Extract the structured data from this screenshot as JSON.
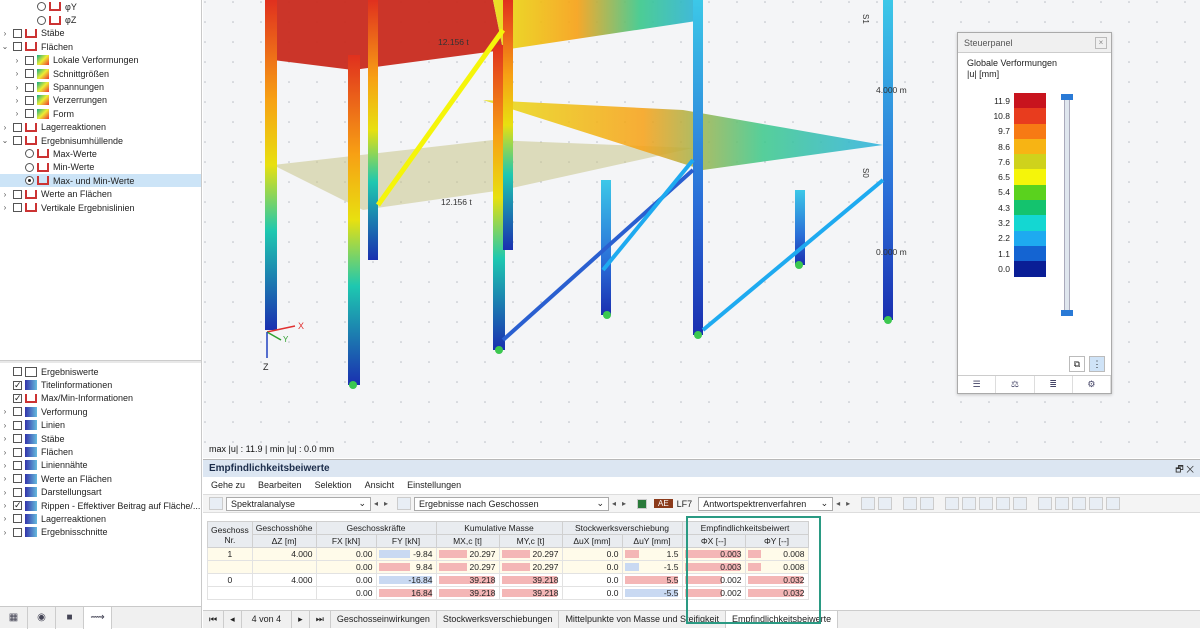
{
  "tree_top": [
    {
      "label": "φY",
      "kind": "radio",
      "indent": 3
    },
    {
      "label": "φZ",
      "kind": "radio",
      "indent": 3
    },
    {
      "label": "Stäbe",
      "kind": "check",
      "indent": 1,
      "expand": "›"
    },
    {
      "label": "Flächen",
      "kind": "check",
      "indent": 1,
      "expand": "⌄"
    },
    {
      "label": "Lokale Verformungen",
      "kind": "check",
      "indent": 2,
      "expand": "›",
      "icon": "surf"
    },
    {
      "label": "Schnittgrößen",
      "kind": "check",
      "indent": 2,
      "expand": "›",
      "icon": "surf"
    },
    {
      "label": "Spannungen",
      "kind": "check",
      "indent": 2,
      "expand": "›",
      "icon": "surf"
    },
    {
      "label": "Verzerrungen",
      "kind": "check",
      "indent": 2,
      "expand": "›",
      "icon": "surf"
    },
    {
      "label": "Form",
      "kind": "check",
      "indent": 2,
      "expand": "›",
      "icon": "surf"
    },
    {
      "label": "Lagerreaktionen",
      "kind": "check",
      "indent": 1,
      "expand": "›"
    },
    {
      "label": "Ergebnisumhüllende",
      "kind": "check",
      "indent": 1,
      "expand": "⌄",
      "icon": "red"
    },
    {
      "label": "Max-Werte",
      "kind": "radio",
      "indent": 2,
      "icon": "red"
    },
    {
      "label": "Min-Werte",
      "kind": "radio",
      "indent": 2,
      "icon": "red"
    },
    {
      "label": "Max- und Min-Werte",
      "kind": "radio",
      "on": true,
      "indent": 2,
      "icon": "red",
      "selected": true
    },
    {
      "label": "Werte an Flächen",
      "kind": "check",
      "indent": 1,
      "expand": "›"
    },
    {
      "label": "Vertikale Ergebnislinien",
      "kind": "check",
      "indent": 1,
      "expand": "›",
      "icon": "red"
    }
  ],
  "tree_bottom": [
    {
      "label": "Ergebniswerte",
      "checked": false,
      "icon": "mm",
      "expand": ""
    },
    {
      "label": "Titelinformationen",
      "checked": true,
      "icon": "blue",
      "expand": ""
    },
    {
      "label": "Max/Min-Informationen",
      "checked": true,
      "icon": "red",
      "expand": ""
    },
    {
      "label": "Verformung",
      "checked": false,
      "icon": "blue",
      "expand": "›"
    },
    {
      "label": "Linien",
      "checked": false,
      "icon": "blue",
      "expand": "›"
    },
    {
      "label": "Stäbe",
      "checked": false,
      "icon": "blue",
      "expand": "›"
    },
    {
      "label": "Flächen",
      "checked": false,
      "icon": "blue",
      "expand": "›"
    },
    {
      "label": "Liniennähte",
      "checked": false,
      "icon": "blue",
      "expand": "›"
    },
    {
      "label": "Werte an Flächen",
      "checked": false,
      "icon": "blue",
      "expand": "›"
    },
    {
      "label": "Darstellungsart",
      "checked": false,
      "icon": "blue",
      "expand": "›"
    },
    {
      "label": "Rippen - Effektiver Beitrag auf Fläche/...",
      "checked": true,
      "icon": "blue",
      "expand": "›"
    },
    {
      "label": "Lagerreaktionen",
      "checked": false,
      "icon": "blue",
      "expand": "›"
    },
    {
      "label": "Ergebnisschnitte",
      "checked": false,
      "icon": "blue",
      "expand": "›"
    }
  ],
  "viewport": {
    "status": "max |u| : 11.9 | min |u| : 0.0 mm",
    "label_mass1": "12.156 t",
    "label_mass2": "12.156 t",
    "label_height1": "4.000 m",
    "label_height2": "0.000 m",
    "label_s1": "S1",
    "label_s0": "S0",
    "axis_x": "X",
    "axis_y": "Y",
    "axis_z": "Z"
  },
  "panel": {
    "header": "Steuerpanel",
    "close": "×",
    "title1": "Globale Verformungen",
    "title2": "|u| [mm]",
    "legend": [
      {
        "value": "11.9",
        "color": "#c8141e"
      },
      {
        "value": "10.8",
        "color": "#e83c1e"
      },
      {
        "value": "9.7",
        "color": "#f77a14"
      },
      {
        "value": "8.6",
        "color": "#f7b414"
      },
      {
        "value": "7.6",
        "color": "#cfd21c"
      },
      {
        "value": "6.5",
        "color": "#f5f50a"
      },
      {
        "value": "5.4",
        "color": "#5ad21e"
      },
      {
        "value": "4.3",
        "color": "#14c36e"
      },
      {
        "value": "3.2",
        "color": "#14d7d2"
      },
      {
        "value": "2.2",
        "color": "#1eaaf0"
      },
      {
        "value": "1.1",
        "color": "#1464d2"
      },
      {
        "value": "0.0",
        "color": "#0a1e96"
      }
    ],
    "slider_top": 1.0,
    "slider_bottom": 0.0
  },
  "bottom": {
    "title": "Empfindlichkeitsbeiwerte",
    "menu": [
      "Gehe zu",
      "Bearbeiten",
      "Selektion",
      "Ansicht",
      "Einstellungen"
    ],
    "dd_analysis": "Spektralanalyse",
    "dd_results": "Ergebnisse nach Geschossen",
    "badge_ae": "AE",
    "lf": "LF7",
    "dd_method": "Antwortspektrenverfahren",
    "col_groups": [
      "Geschoss\nNr.",
      "Geschosshöhe",
      "Geschosskräfte",
      "Kumulative Masse",
      "Stockwerksverschiebung",
      "Empfindlichkeitsbeiwert"
    ],
    "headers": {
      "nr1": "Geschoss",
      "nr2": "Nr.",
      "h1": "Geschosshöhe",
      "h2": "ΔZ [m]",
      "f": "Geschosskräfte",
      "fx": "FX [kN]",
      "fy": "FY [kN]",
      "m": "Kumulative Masse",
      "mx": "MX,c [t]",
      "my": "MY,c [t]",
      "d": "Stockwerksverschiebung",
      "dx": "ΔuX [mm]",
      "dy": "ΔuY [mm]",
      "e": "Empfindlichkeitsbeiwert",
      "ex": "ΦX [--]",
      "ey": "ΦY [--]"
    },
    "rows": [
      {
        "nr": "1",
        "h": "4.000",
        "fx": "0.00",
        "fy": "-9.84",
        "mx": "20.297",
        "my": "20.297",
        "dx": "0.0",
        "dy": "1.5",
        "ex": "0.003",
        "ey": "0.008"
      },
      {
        "nr": "",
        "h": "",
        "fx": "0.00",
        "fy": "9.84",
        "mx": "20.297",
        "my": "20.297",
        "dx": "0.0",
        "dy": "-1.5",
        "ex": "0.003",
        "ey": "0.008"
      },
      {
        "nr": "0",
        "h": "4.000",
        "fx": "0.00",
        "fy": "-16.84",
        "mx": "39.218",
        "my": "39.218",
        "dx": "0.0",
        "dy": "5.5",
        "ex": "0.002",
        "ey": "0.032"
      },
      {
        "nr": "",
        "h": "",
        "fx": "0.00",
        "fy": "16.84",
        "mx": "39.218",
        "my": "39.218",
        "dx": "0.0",
        "dy": "-5.5",
        "ex": "0.002",
        "ey": "0.032"
      }
    ],
    "pager": "4 von 4",
    "tabs": [
      "Geschosseinwirkungen",
      "Stockwerksverschiebungen",
      "Mittelpunkte von Masse und Steifigkeit",
      "Empfindlichkeitsbeiwerte"
    ],
    "active_tab": 3
  }
}
